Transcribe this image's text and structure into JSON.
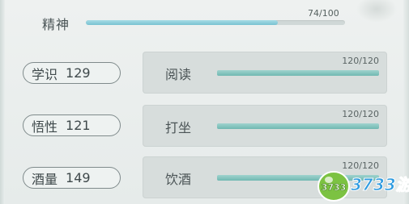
{
  "spirit": {
    "label": "精神",
    "value_text": "74/100",
    "current": 74,
    "max": 100
  },
  "attributes": [
    {
      "name": "学识",
      "value": "129"
    },
    {
      "name": "悟性",
      "value": "121"
    },
    {
      "name": "酒量",
      "value": "149"
    }
  ],
  "activities": [
    {
      "label": "阅读",
      "value_text": "120/120",
      "fraction": 1.0
    },
    {
      "label": "打坐",
      "value_text": "120/120",
      "fraction": 1.0
    },
    {
      "label": "饮酒",
      "value_text": "120/120",
      "fraction": 1.0
    }
  ],
  "watermark": {
    "text": "3733游戏",
    "badge": "3733"
  },
  "colors": {
    "accent_bar": "#79c2d1",
    "activity_bar": "#70b8b2",
    "pill_border": "#7f8a8b"
  }
}
